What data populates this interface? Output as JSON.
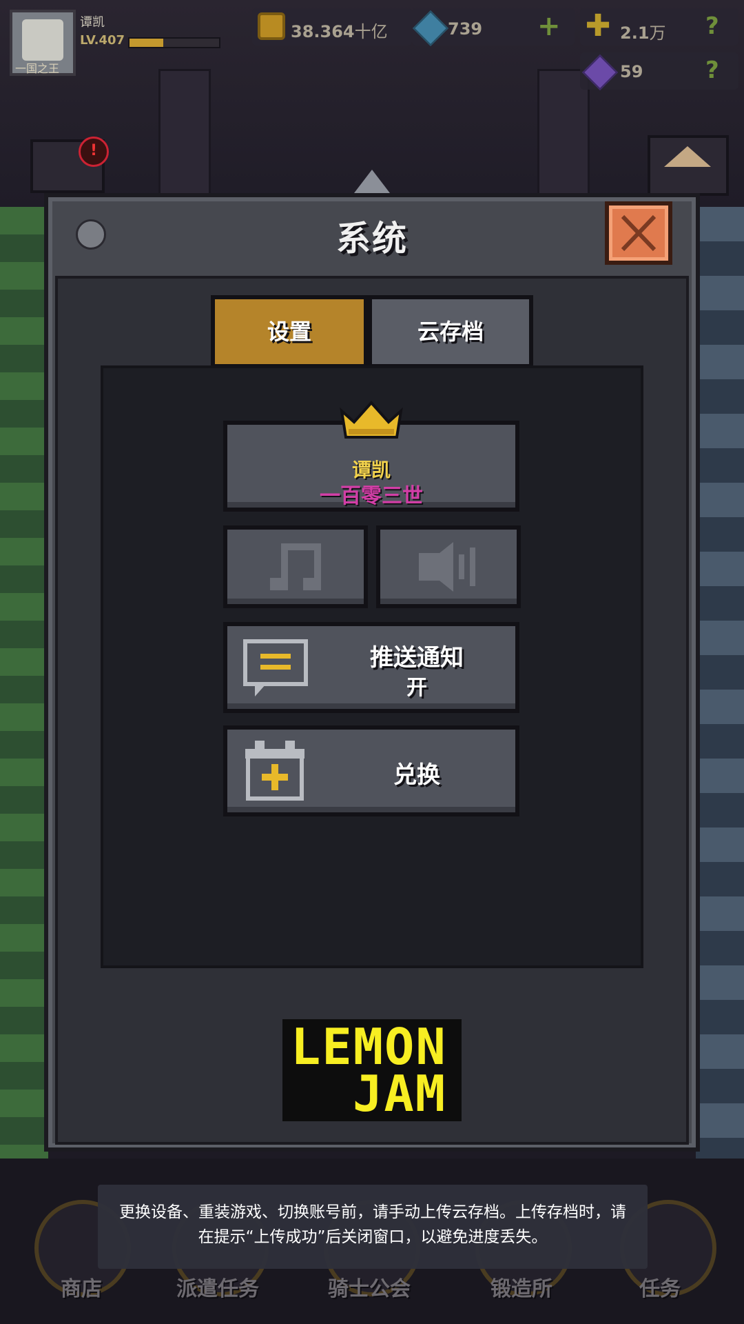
{
  "hud": {
    "player_name": "谭凯",
    "level": "LV.407",
    "title": "一国之王",
    "xp_fraction": 0.38,
    "gold": "38.364",
    "gold_unit": "十亿",
    "gems": "739",
    "cross_value": "2.1",
    "cross_unit": "万",
    "crystals": "59",
    "alert": "!"
  },
  "dialog": {
    "title": "系统",
    "tabs": {
      "settings": "设置",
      "cloud_save": "云存档"
    },
    "profile": {
      "name": "谭凯",
      "generation": "一百零三世"
    },
    "push": {
      "label": "推送通知",
      "state": "开"
    },
    "redeem": {
      "label": "兑换"
    }
  },
  "logo": {
    "line1": "LEMON",
    "line2": "JAM"
  },
  "notice": {
    "text": "更换设备、重装游戏、切换账号前，请手动上传云存档。上传存档时，请在提示“上传成功”后关闭窗口，以避免进度丢失。"
  },
  "nav": {
    "shop": "商店",
    "dispatch": "派遣任务",
    "guild": "骑士公会",
    "forge": "锻造所",
    "quests": "任务"
  },
  "colors": {
    "tab_active": "#b5842a",
    "close_button": "#e07a4e",
    "profile_name": "#f2d24c",
    "profile_generation": "#d23ea6",
    "logo": "#f7ee22"
  }
}
